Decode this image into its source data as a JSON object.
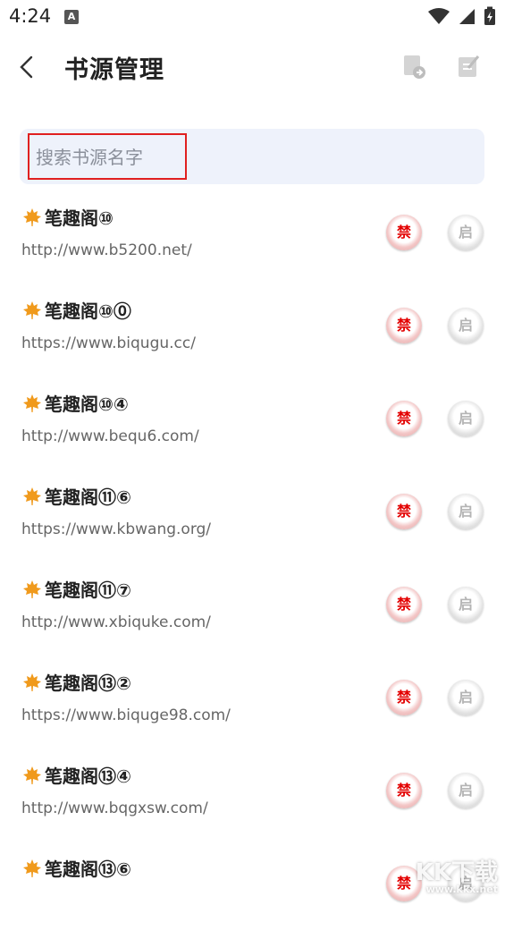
{
  "status": {
    "time": "4:24",
    "notif_letter": "A"
  },
  "toolbar": {
    "title": "书源管理",
    "back_icon": "back-arrow-icon",
    "import_icon": "import-icon",
    "edit_icon": "edit-icon"
  },
  "search": {
    "placeholder": "搜索书源名字",
    "value": ""
  },
  "sources": [
    {
      "name": "笔趣阁⑩",
      "url": "http://www.b5200.net/",
      "ban_label": "禁",
      "enable_label": "启"
    },
    {
      "name": "笔趣阁⑩⓪",
      "url": "https://www.biqugu.cc/",
      "ban_label": "禁",
      "enable_label": "启"
    },
    {
      "name": "笔趣阁⑩④",
      "url": "http://www.bequ6.com/",
      "ban_label": "禁",
      "enable_label": "启"
    },
    {
      "name": "笔趣阁⑪⑥",
      "url": "https://www.kbwang.org/",
      "ban_label": "禁",
      "enable_label": "启"
    },
    {
      "name": "笔趣阁⑪⑦",
      "url": "http://www.xbiquke.com/",
      "ban_label": "禁",
      "enable_label": "启"
    },
    {
      "name": "笔趣阁⑬②",
      "url": "https://www.biquge98.com/",
      "ban_label": "禁",
      "enable_label": "启"
    },
    {
      "name": "笔趣阁⑬④",
      "url": "http://www.bqgxsw.com/",
      "ban_label": "禁",
      "enable_label": "启"
    },
    {
      "name": "笔趣阁⑬⑥",
      "url": "",
      "ban_label": "禁",
      "enable_label": "启"
    }
  ],
  "watermark": {
    "main": "KK下载",
    "sub": "www.kkx.net"
  },
  "colors": {
    "ban": "#e30000",
    "search_bg": "#eef2fb",
    "highlight": "#e02020"
  }
}
